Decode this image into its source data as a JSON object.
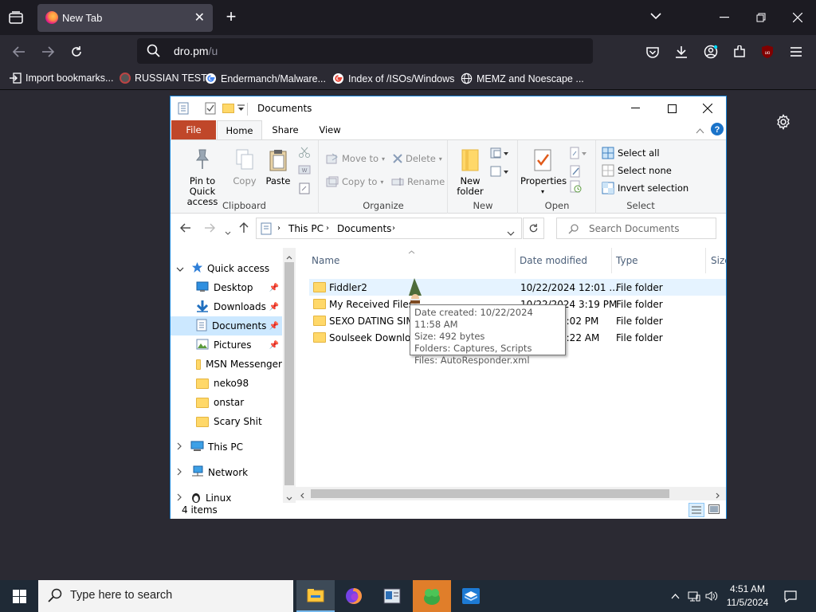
{
  "browser": {
    "tab_title": "New Tab",
    "url_host": "dro.pm",
    "url_path": "/u",
    "bookmarks": [
      {
        "label": "Import bookmarks...",
        "icon": "import-icon"
      },
      {
        "label": "RUSSIAN TEST",
        "icon": "site-favicon"
      },
      {
        "label": "Endermanch/Malware...",
        "icon": "google-icon"
      },
      {
        "label": "Index of /ISOs/Windows",
        "icon": "google-icon"
      },
      {
        "label": "MEMZ and Noescape ...",
        "icon": "globe-icon"
      }
    ]
  },
  "explorer": {
    "title": "Documents",
    "tabs": [
      "File",
      "Home",
      "Share",
      "View"
    ],
    "ribbon": {
      "clipboard": {
        "group": "Clipboard",
        "pin": "Pin to Quick access",
        "copy": "Copy",
        "paste": "Paste"
      },
      "organize": {
        "group": "Organize",
        "move_to": "Move to",
        "copy_to": "Copy to",
        "delete": "Delete",
        "rename": "Rename"
      },
      "new": {
        "group": "New",
        "new_folder": "New folder"
      },
      "open": {
        "group": "Open",
        "properties": "Properties"
      },
      "select": {
        "group": "Select",
        "select_all": "Select all",
        "select_none": "Select none",
        "invert": "Invert selection"
      }
    },
    "breadcrumb": [
      "This PC",
      "Documents"
    ],
    "search_placeholder": "Search Documents",
    "nav": {
      "quick_access": "Quick access",
      "items": [
        {
          "label": "Desktop",
          "pinned": true
        },
        {
          "label": "Downloads",
          "pinned": true
        },
        {
          "label": "Documents",
          "pinned": true,
          "selected": true
        },
        {
          "label": "Pictures",
          "pinned": true
        },
        {
          "label": "MSN Messenger"
        },
        {
          "label": "neko98"
        },
        {
          "label": "onstar"
        },
        {
          "label": "Scary Shit"
        }
      ],
      "this_pc": "This PC",
      "network": "Network",
      "linux": "Linux"
    },
    "columns": [
      "Name",
      "Date modified",
      "Type",
      "Size"
    ],
    "files": [
      {
        "name": "Fiddler2",
        "date": "10/22/2024 12:01 ...",
        "type": "File folder"
      },
      {
        "name": "My Received Files",
        "date": "10/22/2024 3:19 PM",
        "type": "File folder"
      },
      {
        "name": "SEXO DATING SIM-v",
        "date": "1:02 PM",
        "type": "File folder"
      },
      {
        "name": "Soulseek Download",
        "date": "4:22 AM",
        "type": "File folder"
      }
    ],
    "tooltip": {
      "line1": "Date created: 10/22/2024 11:58 AM",
      "line2": "Size: 492 bytes",
      "line3": "Folders: Captures, Scripts",
      "line4": "Files: AutoResponder.xml"
    },
    "status": "4 items"
  },
  "taskbar": {
    "search_placeholder": "Type here to search",
    "time": "4:51 AM",
    "date": "11/5/2024"
  },
  "colors": {
    "accent": "#1883d7",
    "file_tab": "#c0472a",
    "folder": "#ffd869"
  }
}
